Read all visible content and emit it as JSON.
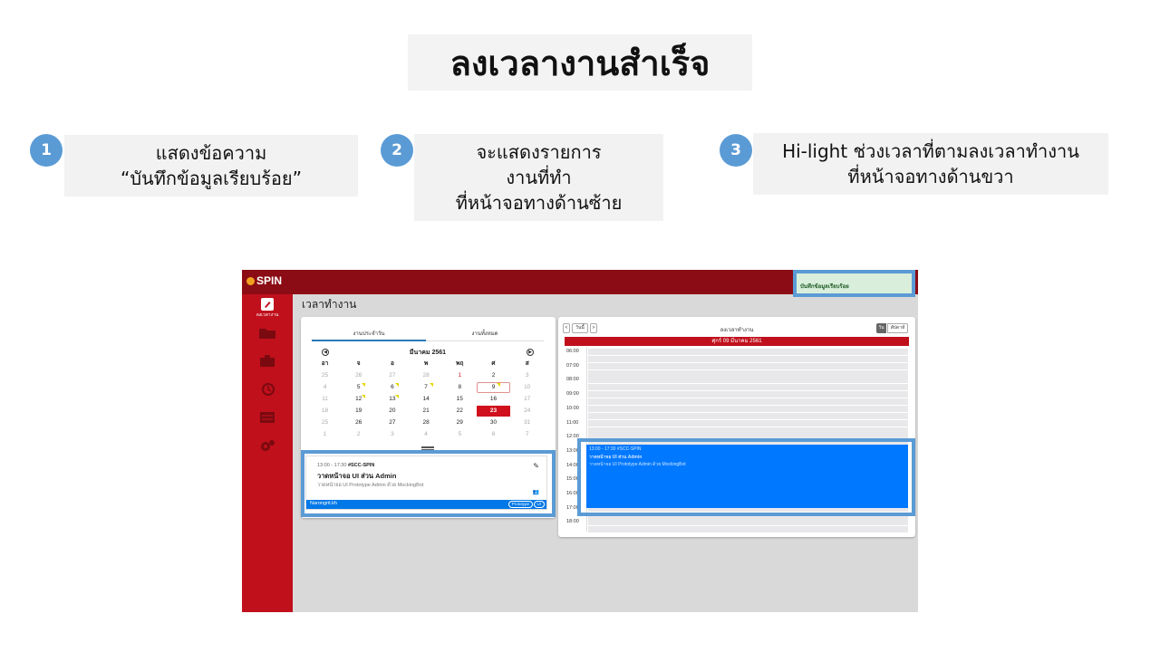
{
  "slide": {
    "title": "ลงเวลางานสำเร็จ",
    "steps": [
      {
        "number": "1",
        "lines": [
          "แสดงข้อความ",
          "“บันทึกข้อมูลเรียบร้อย”"
        ]
      },
      {
        "number": "2",
        "lines": [
          "จะแสดงรายการ",
          "งานที่ทำ",
          "ที่หน้าจอทางด้านซ้าย"
        ]
      },
      {
        "number": "3",
        "lines": [
          "Hi-light ช่วงเวลาที่ตามลงเวลาทำงาน",
          "ที่หน้าจอทางด้านขวา"
        ]
      }
    ]
  },
  "app": {
    "logo": "SPIN",
    "sidebar_label": "ลงเวลางาน",
    "page_title": "เวลาทำงาน",
    "toast": "บันทึกข้อมูลเรียบร้อย",
    "colors": {
      "brand_red": "#c0101c",
      "topbar": "#8b0c14",
      "event_blue": "#0078ff",
      "highlight": "#5b9bd5"
    },
    "left_panel": {
      "tabs": [
        "งานประจำวัน",
        "งานทั้งหมด"
      ],
      "calendar": {
        "month": "มีนาคม 2561",
        "weekdays": [
          "อา",
          "จ",
          "อ",
          "พ",
          "พฤ",
          "ศ",
          "ส"
        ],
        "weeks": [
          [
            "25",
            "26",
            "27",
            "28",
            "1",
            "2",
            "3"
          ],
          [
            "4",
            "5",
            "6",
            "7",
            "8",
            "9",
            "10"
          ],
          [
            "11",
            "12",
            "13",
            "14",
            "15",
            "16",
            "17"
          ],
          [
            "18",
            "19",
            "20",
            "21",
            "22",
            "23",
            "24"
          ],
          [
            "25",
            "26",
            "27",
            "28",
            "29",
            "30",
            "31"
          ],
          [
            "1",
            "2",
            "3",
            "4",
            "5",
            "6",
            "7"
          ]
        ],
        "selected_day": "9",
        "today": "23"
      },
      "task": {
        "time": "13:00 - 17:30",
        "code": "#SCC-SPIN",
        "title": "วาดหน้าจอ UI ส่วน Admin",
        "description": "วาดหน้าจอ UI Prototype Admin ด้วย MockingBot",
        "user": "Narongrit.kh",
        "tags": [
          "Prototype",
          "UI"
        ]
      }
    },
    "right_panel": {
      "prev_label": "<",
      "today_label": "วันนี้",
      "next_label": ">",
      "title": "ลงเวลาทำงาน",
      "view_day": "วัน",
      "view_week": "สัปดาห์",
      "date": "ศุกร์ 09 มีนาคม 2561",
      "times": [
        "06:00",
        "07:00",
        "08:00",
        "09:00",
        "10:00",
        "11:00",
        "12:00",
        "13:00",
        "14:00",
        "15:00",
        "16:00",
        "17:00",
        "18:00"
      ],
      "event": {
        "time": "13:00 - 17:30",
        "code": "#SCC-SPIN",
        "title": "วาดหน้าจอ UI ส่วน Admin",
        "description": "วาดหน้าจอ UI Prototype Admin ด้วย MockingBot"
      }
    }
  }
}
